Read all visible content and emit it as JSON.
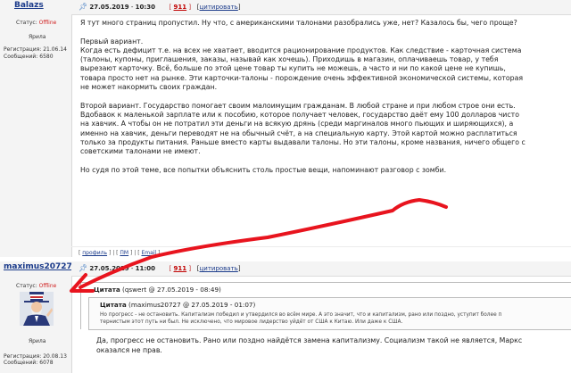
{
  "post1": {
    "author": "Balazs",
    "status_label": "Статус:",
    "status_value": "Offline",
    "location": "Ярила",
    "reg_label": "Регистрация:",
    "reg_date": "21.06.14",
    "msgs_label": "Сообщений:",
    "msgs_count": "6580",
    "date": "27.05.2019",
    "time": "10:30",
    "post_number": "911",
    "quote_button": "цитировать",
    "paragraphs": [
      [
        "Я тут много страниц пропустил. Ну что, с американскими талонами разобрались уже, нет? Казалось бы, чего проще?"
      ],
      [
        "Первый вариант.",
        "Когда есть дефицит т.е. на всех не хватает, вводится рационирование продуктов. Как следствие - карточная система",
        "(талоны, купоны, приглашения, заказы, называй как хочешь). Приходишь в магазин, оплачиваешь товар, у тебя",
        "вырезают карточку. Всё, больше по этой цене товар ты купить не можешь, а часто и ни по какой цене не купишь,",
        "товара просто нет на рынке. Эти карточки-талоны - порождение очень эффективной экономической системы, которая",
        "не может накормить своих граждан."
      ],
      [
        "Второй вариант. Государство помогает своим малоимущим гражданам. В любой стране и при любом строе они есть.",
        "Вдобавок к маленькой зарплате или к пособию, которое получает человек, государство даёт ему 100 долларов чисто",
        "на хавчик. А чтобы он не потратил эти деньги на всякую дрянь (среди маргиналов много пьющих и ширяющихся), а",
        "именно на хавчик, деньги переводят не на обычный счёт, а на специальную карту. Этой картой можно расплатиться",
        "только за продукты питания. Раньше вместо карты выдавали талоны. Но эти талоны, кроме названия, ничего общего с",
        "советскими талонами не имеют."
      ],
      [
        "Но судя по этой теме, все попытки объяснить столь простые вещи, напоминают разговор с зомби."
      ]
    ],
    "footer": {
      "profile": "профиль",
      "pm": "ПМ",
      "email": "Email"
    }
  },
  "post2": {
    "author": "maximus20727",
    "status_label": "Статус:",
    "status_value": "Offline",
    "location": "Ярила",
    "reg_label": "Регистрация:",
    "reg_date": "20.08.13",
    "msgs_label": "Сообщений:",
    "msgs_count": "6078",
    "date": "27.05.2019",
    "time": "11:00",
    "post_number": "911",
    "quote_button": "цитировать",
    "outer_quote": {
      "label": "Цитата",
      "meta": "(qswert @ 27.05.2019 - 08:49)"
    },
    "inner_quote": {
      "label": "Цитата",
      "meta": "(maximus20727 @ 27.05.2019 - 01:07)",
      "line1": "Но прогресс - не остановить. Капитализм победил и утвердился во всём мире.  А это значит, что и капитализм, рано или поздно, уступит более п",
      "line2": "тернистым этот путь ни был. Не исключено, что мировое лидерство уйдёт от США к Китаю. Или даже к США."
    },
    "reply": [
      "Да, прогресс не остановить. Рано или поздно найдётся замена капитализму. Социализм такой не является, Маркс",
      "оказался не прав."
    ]
  },
  "colors": {
    "author": "#1a3a8a",
    "offline": "#d02020",
    "arrow": "#e8141e"
  },
  "icons": {
    "post_pin": "thumbtack-icon",
    "avatar": "uncle-sam-avatar"
  }
}
